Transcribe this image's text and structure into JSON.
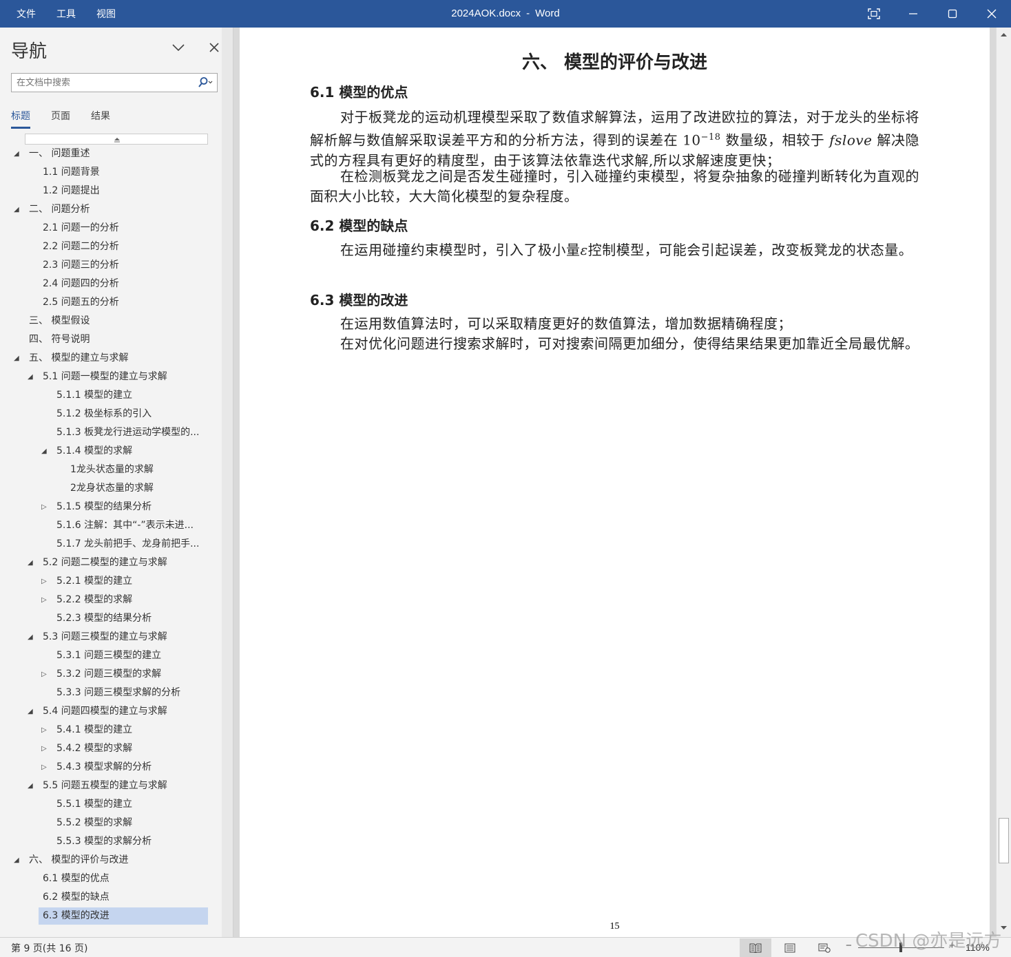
{
  "menu": {
    "file": "文件",
    "tools": "工具",
    "view": "视图"
  },
  "window": {
    "filename": "2024AOK.docx",
    "separator": "-",
    "app": "Word"
  },
  "nav": {
    "title": "导航",
    "search_placeholder": "在文档中搜索",
    "tabs": [
      "标题",
      "页面",
      "结果"
    ],
    "items": [
      {
        "label": "一、 问题重述",
        "level": 0,
        "toggle": "expanded"
      },
      {
        "label": "1.1 问题背景",
        "level": 1,
        "toggle": "none"
      },
      {
        "label": "1.2 问题提出",
        "level": 1,
        "toggle": "none"
      },
      {
        "label": "二、 问题分析",
        "level": 0,
        "toggle": "expanded"
      },
      {
        "label": "2.1 问题一的分析",
        "level": 1,
        "toggle": "none"
      },
      {
        "label": "2.2 问题二的分析",
        "level": 1,
        "toggle": "none"
      },
      {
        "label": "2.3 问题三的分析",
        "level": 1,
        "toggle": "none"
      },
      {
        "label": "2.4 问题四的分析",
        "level": 1,
        "toggle": "none"
      },
      {
        "label": "2.5 问题五的分析",
        "level": 1,
        "toggle": "none"
      },
      {
        "label": "三、 模型假设",
        "level": 0,
        "toggle": "none"
      },
      {
        "label": "四、 符号说明",
        "level": 0,
        "toggle": "none"
      },
      {
        "label": "五、 模型的建立与求解",
        "level": 0,
        "toggle": "expanded"
      },
      {
        "label": "5.1 问题一模型的建立与求解",
        "level": 1,
        "toggle": "expanded"
      },
      {
        "label": "5.1.1 模型的建立",
        "level": 2,
        "toggle": "none"
      },
      {
        "label": "5.1.2 极坐标系的引入",
        "level": 2,
        "toggle": "none"
      },
      {
        "label": "5.1.3 板凳龙行进运动学模型的...",
        "level": 2,
        "toggle": "none"
      },
      {
        "label": "5.1.4 模型的求解",
        "level": 2,
        "toggle": "expanded"
      },
      {
        "label": "1龙头状态量的求解",
        "level": 3,
        "toggle": "none"
      },
      {
        "label": "2龙身状态量的求解",
        "level": 3,
        "toggle": "none"
      },
      {
        "label": "5.1.5 模型的结果分析",
        "level": 2,
        "toggle": "collapsed"
      },
      {
        "label": "5.1.6 注解：其中“-”表示未进...",
        "level": 2,
        "toggle": "none"
      },
      {
        "label": "5.1.7 龙头前把手、龙身前把手...",
        "level": 2,
        "toggle": "none"
      },
      {
        "label": "5.2 问题二模型的建立与求解",
        "level": 1,
        "toggle": "expanded"
      },
      {
        "label": "5.2.1 模型的建立",
        "level": 2,
        "toggle": "collapsed"
      },
      {
        "label": "5.2.2 模型的求解",
        "level": 2,
        "toggle": "collapsed"
      },
      {
        "label": "5.2.3 模型的结果分析",
        "level": 2,
        "toggle": "none"
      },
      {
        "label": "5.3 问题三模型的建立与求解",
        "level": 1,
        "toggle": "expanded"
      },
      {
        "label": "5.3.1 问题三模型的建立",
        "level": 2,
        "toggle": "none"
      },
      {
        "label": "5.3.2 问题三模型的求解",
        "level": 2,
        "toggle": "collapsed"
      },
      {
        "label": "5.3.3 问题三模型求解的分析",
        "level": 2,
        "toggle": "none"
      },
      {
        "label": "5.4 问题四模型的建立与求解",
        "level": 1,
        "toggle": "expanded"
      },
      {
        "label": "5.4.1 模型的建立",
        "level": 2,
        "toggle": "collapsed"
      },
      {
        "label": "5.4.2 模型的求解",
        "level": 2,
        "toggle": "collapsed"
      },
      {
        "label": "5.4.3 模型求解的分析",
        "level": 2,
        "toggle": "collapsed"
      },
      {
        "label": "5.5 问题五模型的建立与求解",
        "level": 1,
        "toggle": "expanded"
      },
      {
        "label": "5.5.1 模型的建立",
        "level": 2,
        "toggle": "none"
      },
      {
        "label": "5.5.2 模型的求解",
        "level": 2,
        "toggle": "none"
      },
      {
        "label": "5.5.3 模型的求解分析",
        "level": 2,
        "toggle": "none"
      },
      {
        "label": "六、 模型的评价与改进",
        "level": 0,
        "toggle": "expanded"
      },
      {
        "label": "6.1 模型的优点",
        "level": 1,
        "toggle": "none"
      },
      {
        "label": "6.2 模型的缺点",
        "level": 1,
        "toggle": "none"
      },
      {
        "label": "6.3 模型的改进",
        "level": 1,
        "toggle": "none",
        "selected": true
      }
    ]
  },
  "doc": {
    "heading": "六、 模型的评价与改进",
    "s1_title": "6.1 模型的优点",
    "p1_a": "对于板凳龙的运动机理模型采取了数值求解算法，运用了改进欧拉的算法，对于龙头的坐标将解析解与数值解采取误差平方和的分析方法，得到的误差在 10",
    "p1_exp": "−18",
    "p1_b": " 数量级，相较于 ",
    "p1_italic": "fslove",
    "p1_c": " 解决隐式的方程具有更好的精度型，由于该算法依靠迭代求解,所以求解速度更快；",
    "p2": "在检测板凳龙之间是否发生碰撞时，引入碰撞约束模型，将复杂抽象的碰撞判断转化为直观的面积大小比较，大大简化模型的复杂程度。",
    "s2_title": "6.2 模型的缺点",
    "p3_a": "在运用碰撞约束模型时，引入了极小量",
    "p3_eps": "ε",
    "p3_b": "控制模型，可能会引起误差，改变板凳龙的状态量。",
    "s3_title": "6.3 模型的改进",
    "p4": "在运用数值算法时，可以采取精度更好的数值算法，增加数据精确程度；",
    "p5": "在对优化问题进行搜索求解时，可对搜索间隔更加细分，使得结果结果更加靠近全局最优解。",
    "page_number": "15"
  },
  "status": {
    "page_info": "第 9 页(共 16 页)",
    "zoom": "110%",
    "zoom_minus": "−",
    "zoom_plus": "+"
  },
  "watermark": "CSDN @亦是远方",
  "colors": {
    "titlebar": "#2b579a",
    "accent": "#2b579a",
    "selected": "#c5d5ef"
  }
}
